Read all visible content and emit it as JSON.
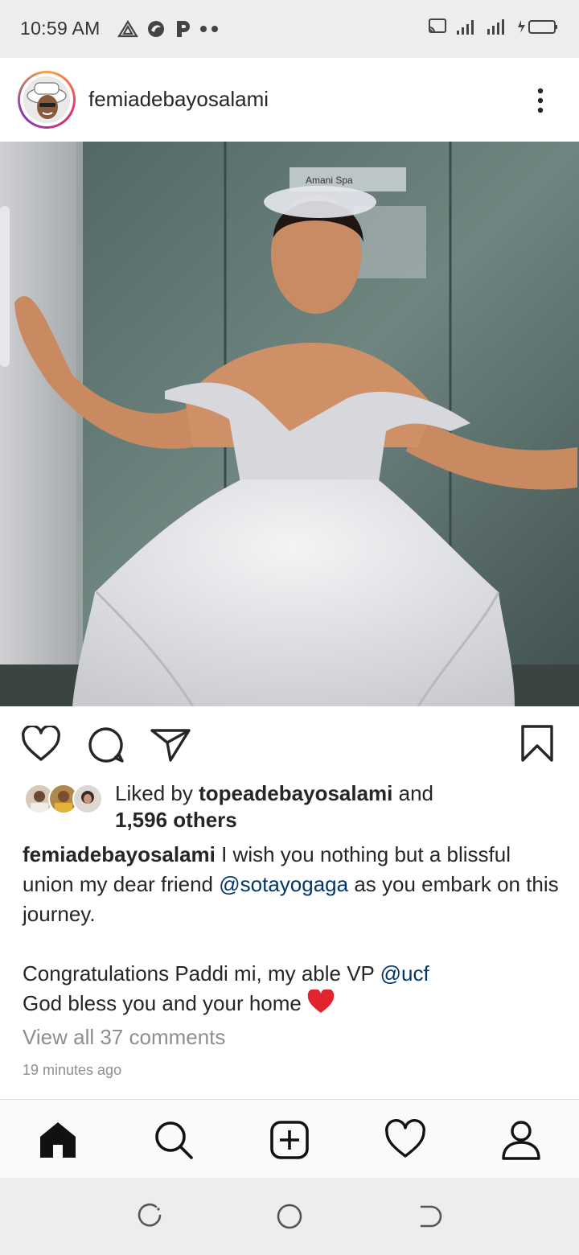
{
  "status_bar": {
    "time": "10:59 AM",
    "left_icons": [
      "triangle-icon",
      "app-icon",
      "p-icon",
      "more-dots-icon"
    ],
    "right_icons": [
      "cast-icon",
      "signal-icon",
      "data-signal-icon",
      "battery-charging-icon"
    ]
  },
  "post": {
    "username": "femiadebayosalami",
    "image_sign_text": "Amani Spa",
    "likes": {
      "prefix": "Liked by ",
      "liker": "topeadebayosalami",
      "conjunction": " and",
      "others": "1,596 others"
    },
    "caption": {
      "username": "femiadebayosalami",
      "line1_text": " I wish you nothing but a blissful union my dear friend ",
      "mention1": "@sotayogaga",
      "line1_tail": " as you embark on this journey.",
      "line2_text": "Congratulations Paddi mi, my able VP ",
      "mention2": "@ucf",
      "line3_text": "God bless you and your home ",
      "emoji": "❤️"
    },
    "view_comments": "View all 37 comments",
    "timestamp": "19 minutes ago"
  },
  "bottom_nav": {
    "items": [
      "home-icon",
      "search-icon",
      "new-post-icon",
      "activity-heart-icon",
      "profile-icon"
    ]
  },
  "system_nav": {
    "items": [
      "recents-icon",
      "home-circle-icon",
      "back-icon"
    ]
  },
  "colors": {
    "accent_link": "#00376b",
    "secondary_text": "#8e8e8e",
    "heart_red": "#e0252f"
  }
}
